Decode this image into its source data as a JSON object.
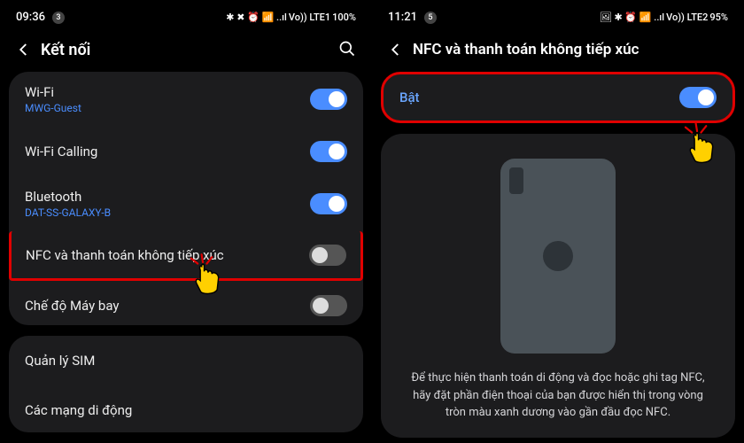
{
  "left": {
    "status": {
      "time": "09:36",
      "notif_count": "3",
      "icons": "✱ ✖ ⏰ 📶 ..ıl",
      "net": "Vo)) LTE1",
      "battery": "100%"
    },
    "header": {
      "title": "Kết nối"
    },
    "panel1": [
      {
        "label": "Wi-Fi",
        "sub": "MWG-Guest",
        "on": true
      },
      {
        "label": "Wi-Fi Calling",
        "sub": "",
        "on": true
      },
      {
        "label": "Bluetooth",
        "sub": "DAT-SS-GALAXY-B",
        "on": true
      },
      {
        "label": "NFC và thanh toán không tiếp xúc",
        "sub": "",
        "on": false
      },
      {
        "label": "Chế độ Máy bay",
        "sub": "",
        "on": false
      }
    ],
    "panel2": [
      {
        "label": "Quản lý SIM"
      },
      {
        "label": "Các mạng di động"
      }
    ]
  },
  "right": {
    "status": {
      "time": "11:21",
      "notif_count": "5",
      "icons": "🖼 ✱ ⏰ 📶 ..ıl",
      "net": "Vo)) LTE2",
      "battery": "95%"
    },
    "header": {
      "title": "NFC và thanh toán không tiếp xúc"
    },
    "toggle": {
      "label": "Bật",
      "on": true
    },
    "desc": "Để thực hiện thanh toán di động và đọc hoặc ghi tag NFC, hãy đặt phần điện thoại của bạn được hiển thị trong vòng tròn màu xanh dương vào gần đầu đọc NFC."
  }
}
